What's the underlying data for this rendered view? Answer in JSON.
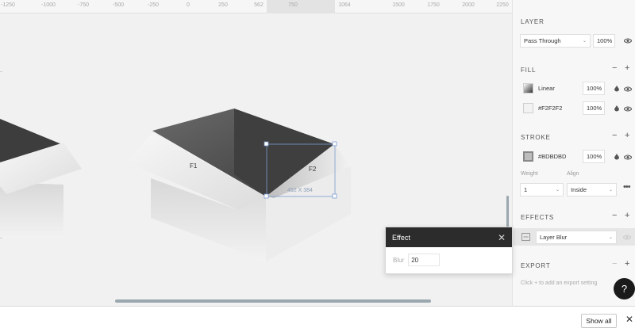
{
  "ruler": {
    "ticks": [
      "-1250",
      "-1000",
      "-750",
      "-500",
      "-250",
      "0",
      "250",
      "562",
      "750",
      "1064",
      "1500",
      "1750",
      "2000",
      "2250"
    ]
  },
  "canvas": {
    "frames": [
      {
        "label": "F1"
      },
      {
        "label": "F2"
      }
    ],
    "selection_size": "492 X 384"
  },
  "effect_popup": {
    "title": "Effect",
    "blur_label": "Blur",
    "blur_value": "20"
  },
  "panel": {
    "layer": {
      "title": "LAYER",
      "blend_mode": "Pass Through",
      "opacity": "100%"
    },
    "fill": {
      "title": "FILL",
      "items": [
        {
          "type": "Linear",
          "opacity": "100%"
        },
        {
          "type": "#F2F2F2",
          "opacity": "100%",
          "color": "#F2F2F2"
        }
      ]
    },
    "stroke": {
      "title": "STROKE",
      "color_label": "#BDBDBD",
      "color": "#BDBDBD",
      "opacity": "100%",
      "weight_label": "Weight",
      "weight_value": "1",
      "align_label": "Align",
      "align_value": "Inside"
    },
    "effects": {
      "title": "EFFECTS",
      "effect_type": "Layer Blur"
    },
    "export": {
      "title": "EXPORT",
      "hint": "Click + to add an export setting"
    }
  },
  "bottom": {
    "show_all": "Show all"
  }
}
